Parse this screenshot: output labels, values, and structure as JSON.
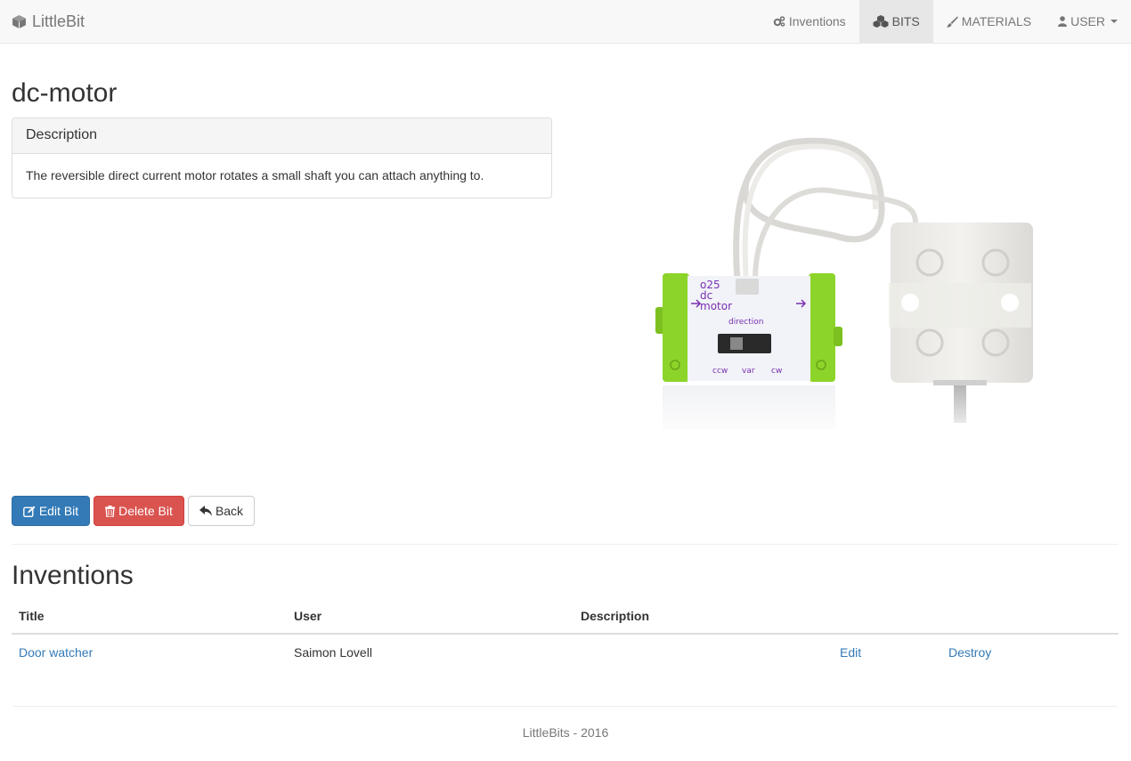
{
  "navbar": {
    "brand": "LittleBit",
    "brand_icon": "cube-icon",
    "items": [
      {
        "label": "Inventions",
        "icon": "cogs-icon"
      },
      {
        "label": "BITS",
        "icon": "cubes-icon",
        "active": true
      },
      {
        "label": "MATERIALS",
        "icon": "paint-brush-icon"
      },
      {
        "label": "USER",
        "icon": "user-icon",
        "dropdown": true
      }
    ]
  },
  "page": {
    "title": "dc-motor",
    "description_heading": "Description",
    "description": "The reversible direct current motor rotates a small shaft you can attach anything to."
  },
  "image": {
    "label_number": "o25",
    "label_line1": "dc",
    "label_line2": "motor",
    "switch_title": "direction",
    "switch_labels": [
      "ccw",
      "var",
      "cw"
    ]
  },
  "buttons": {
    "edit": "Edit Bit",
    "delete": "Delete Bit",
    "back": "Back"
  },
  "inventions": {
    "heading": "Inventions",
    "columns": [
      "Title",
      "User",
      "Description"
    ],
    "rows": [
      {
        "title": "Door watcher",
        "user": "Saimon Lovell",
        "description": "",
        "edit": "Edit",
        "destroy": "Destroy"
      }
    ]
  },
  "footer": {
    "text": "LittleBits - 2016"
  },
  "colors": {
    "primary": "#337ab7",
    "danger": "#d9534f",
    "bit_green": "#8dd42a",
    "bit_label_purple": "#7a2fb0"
  }
}
